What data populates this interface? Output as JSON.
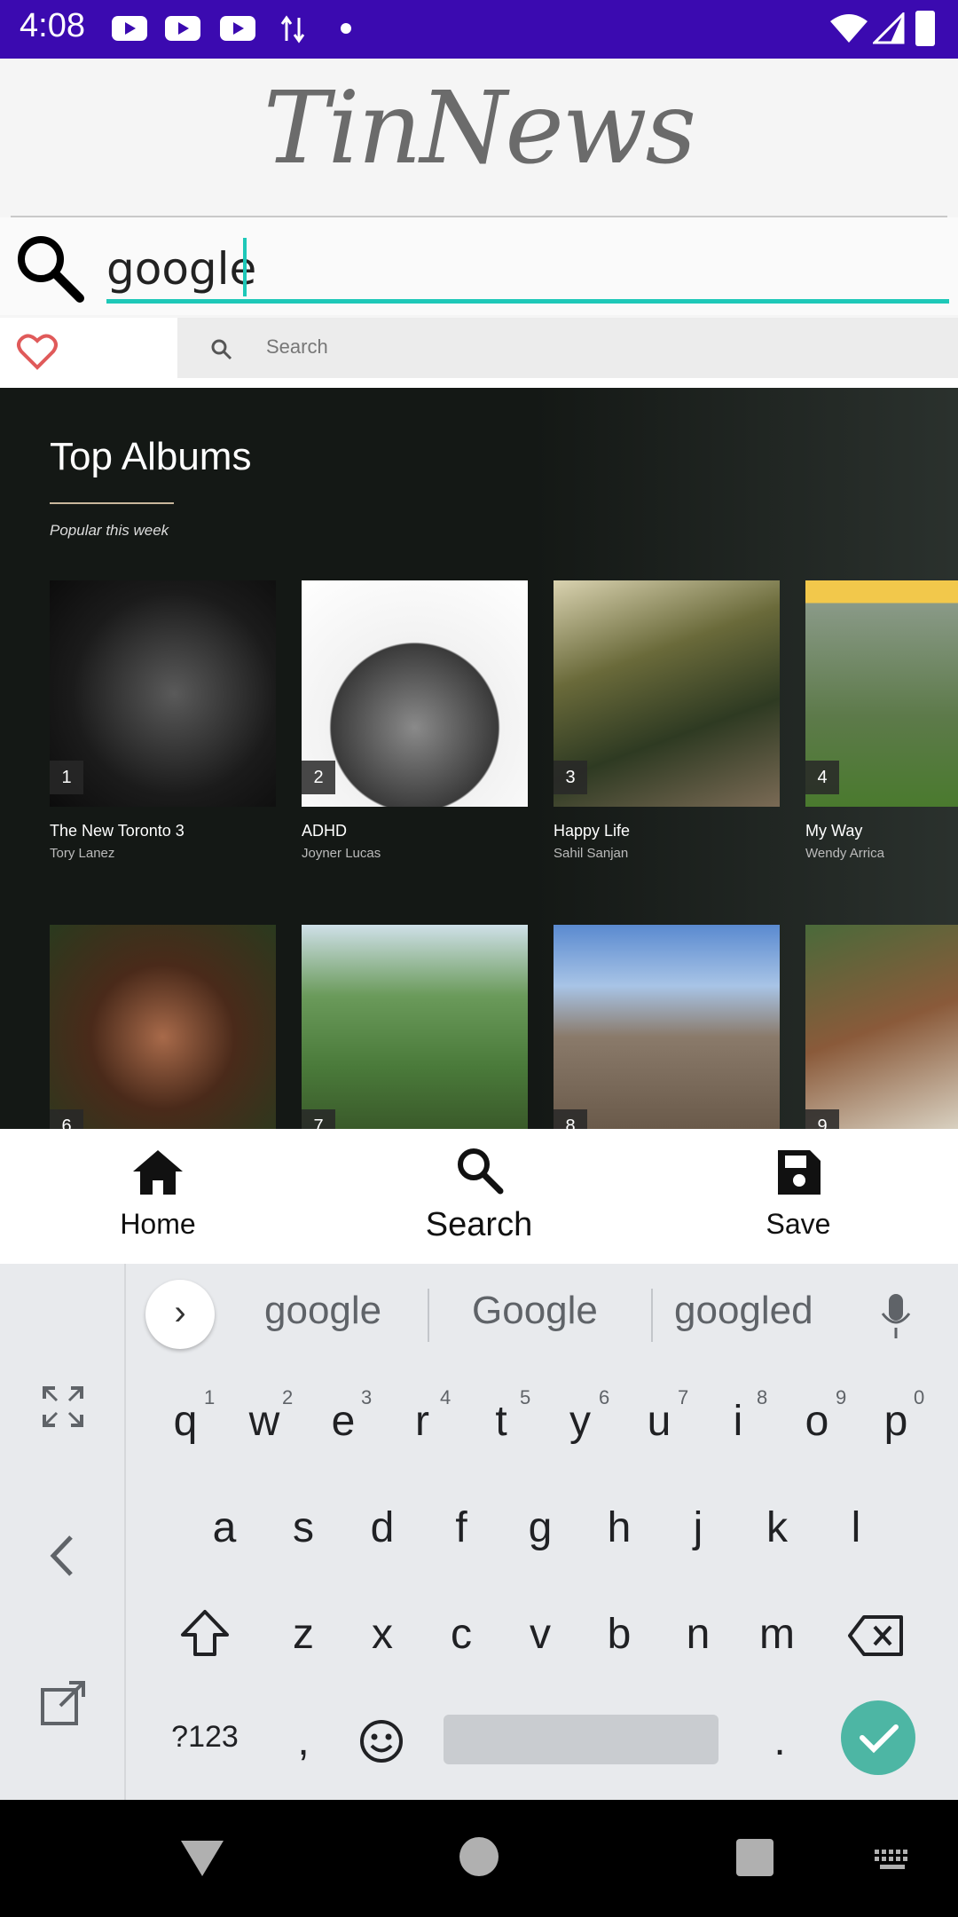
{
  "status_bar": {
    "time": "4:08"
  },
  "app": {
    "title": "TinNews"
  },
  "search": {
    "query": "google"
  },
  "web_toolbar": {
    "search_placeholder": "Search"
  },
  "albums": {
    "title": "Top Albums",
    "subtitle": "Popular this week",
    "items": [
      {
        "rank": "1",
        "name": "The New Toronto 3",
        "artist": "Tory Lanez"
      },
      {
        "rank": "2",
        "name": "ADHD",
        "artist": "Joyner Lucas"
      },
      {
        "rank": "3",
        "name": "Happy Life",
        "artist": "Sahil Sanjan"
      },
      {
        "rank": "4",
        "name": "My Way",
        "artist": "Wendy Arrica"
      },
      {
        "rank": "6"
      },
      {
        "rank": "7"
      },
      {
        "rank": "8"
      },
      {
        "rank": "9"
      }
    ]
  },
  "bottom_nav": {
    "home": "Home",
    "search": "Search",
    "save": "Save"
  },
  "keyboard": {
    "suggestions": [
      "google",
      "Google",
      "googled"
    ],
    "row1": [
      "q",
      "w",
      "e",
      "r",
      "t",
      "y",
      "u",
      "i",
      "o",
      "p"
    ],
    "row1_hints": [
      "1",
      "2",
      "3",
      "4",
      "5",
      "6",
      "7",
      "8",
      "9",
      "0"
    ],
    "row2": [
      "a",
      "s",
      "d",
      "f",
      "g",
      "h",
      "j",
      "k",
      "l"
    ],
    "row3": [
      "z",
      "x",
      "c",
      "v",
      "b",
      "n",
      "m"
    ],
    "symbols_label": "?123",
    "comma": ",",
    "period": "."
  }
}
